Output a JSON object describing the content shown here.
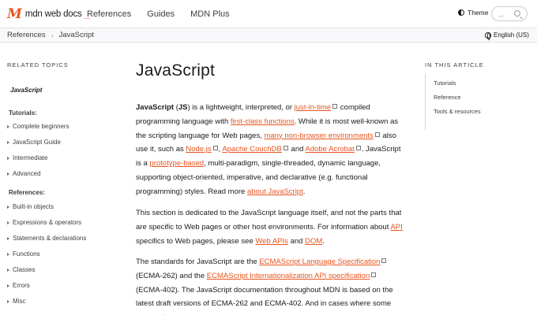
{
  "header": {
    "logo_mark": "M",
    "logo_text": "mdn web docs",
    "logo_underscore": "_",
    "nav": [
      "References",
      "Guides",
      "MDN Plus"
    ],
    "theme_label": "Theme",
    "search_underscore": "_"
  },
  "breadcrumb": {
    "items": [
      "References",
      "JavaScript"
    ],
    "separator": "›",
    "language": "English (US)"
  },
  "sidebar": {
    "heading": "RELATED TOPICS",
    "current": "JavaScript",
    "tutorials_label": "Tutorials:",
    "tutorials": [
      "Complete beginners",
      "JavaScript Guide",
      "Intermediate",
      "Advanced"
    ],
    "references_label": "References:",
    "references": [
      "Built-in objects",
      "Expressions & operators",
      "Statements & declarations",
      "Functions",
      "Classes",
      "Errors",
      "Misc"
    ]
  },
  "main": {
    "title": "JavaScript",
    "p1": {
      "s1": "JavaScript",
      "s2": " (",
      "s3": "JS",
      "s4": ") is a lightweight, interpreted, or ",
      "l1": "just-in-time",
      "s5": " compiled programming language with ",
      "l2": "first-class functions",
      "s6": ". While it is most well-known as the scripting language for Web pages, ",
      "l3": "many non-browser environments",
      "s7": " also use it, such as ",
      "l4": "Node.js",
      "s8": ", ",
      "l5": "Apache CouchDB",
      "s9": " and ",
      "l6": "Adobe Acrobat",
      "s10": ". JavaScript is a ",
      "l7": "prototype-based",
      "s11": ", multi-paradigm, single-threaded, dynamic language, supporting object-oriented, imperative, and declarative (e.g. functional programming) styles. Read more ",
      "l8": "about JavaScript",
      "s12": "."
    },
    "p2": {
      "s1": "This section is dedicated to the JavaScript language itself, and not the parts that are specific to Web pages or other host environments. For information about ",
      "l1": "API",
      "s2": " specifics to Web pages, please see ",
      "l2": "Web APIs",
      "s3": " and ",
      "l3": "DOM",
      "s4": "."
    },
    "p3": {
      "s1": "The standards for JavaScript are the ",
      "l1": "ECMAScript Language Specification",
      "s2": " (ECMA-262) and the ",
      "l2": "ECMAScript Internationalization API specification",
      "s3": " (ECMA-402). The JavaScript documentation throughout MDN is based on the latest draft versions of ECMA-262 and ECMA-402. And in cases where some ",
      "l3": "proposals"
    }
  },
  "toc": {
    "heading": "IN THIS ARTICLE",
    "items": [
      "Tutorials",
      "Reference",
      "Tools & resources"
    ]
  },
  "colors": {
    "accent": "#e8541e",
    "text": "#1b1b1b",
    "border": "#e2e2e2"
  },
  "icons": [
    "theme-icon",
    "search-icon",
    "globe-icon",
    "chevron-right-icon",
    "external-link-icon"
  ]
}
